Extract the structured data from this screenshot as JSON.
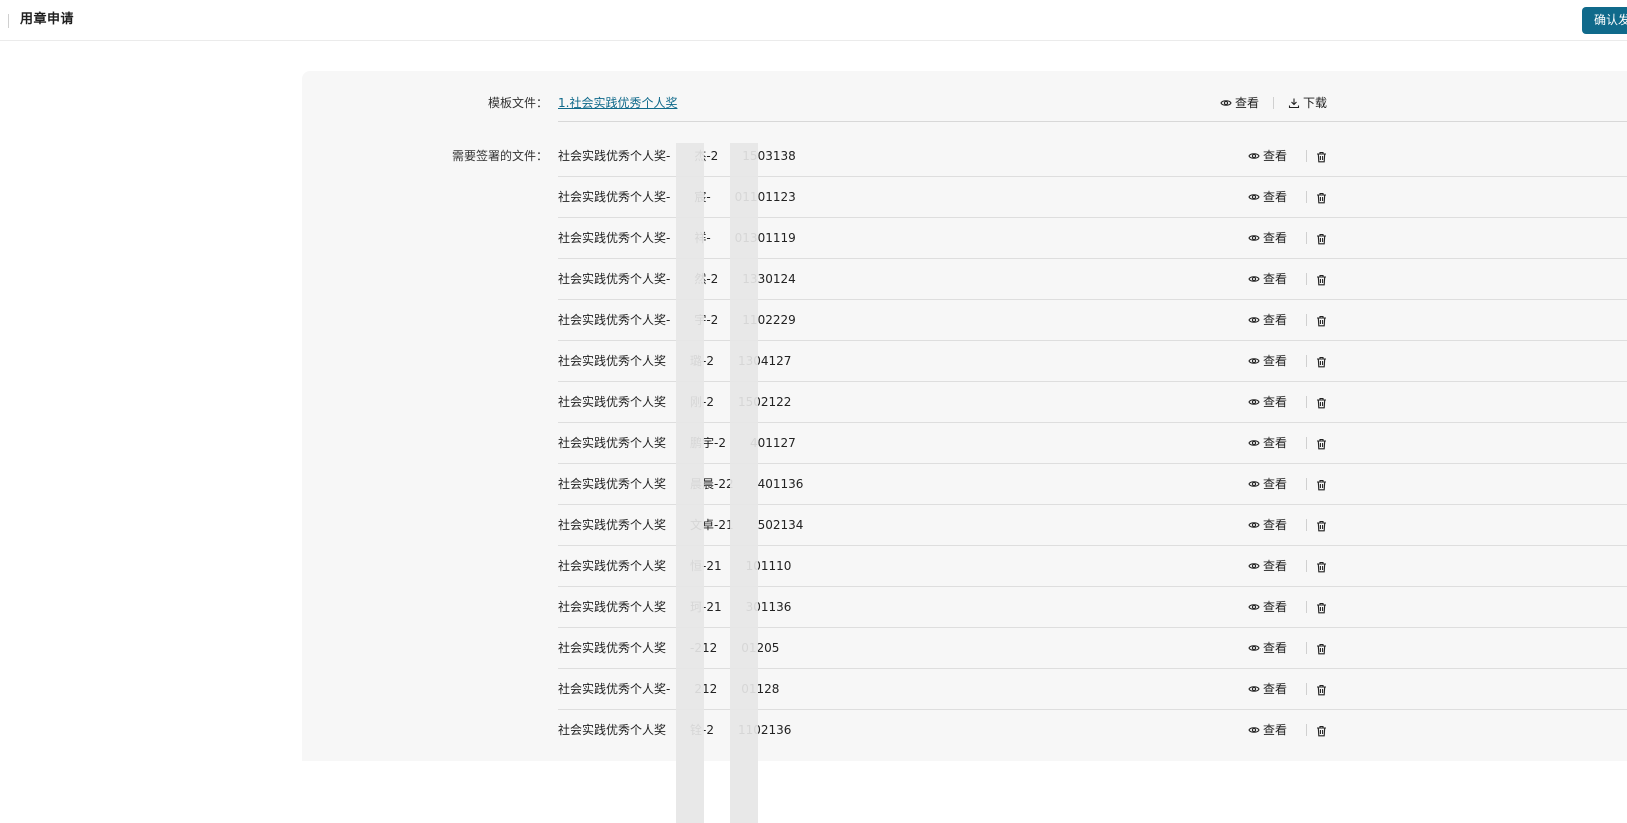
{
  "header": {
    "title": "用章申请",
    "confirm_label": "确认发"
  },
  "template": {
    "label": "模板文件：",
    "file_name": "1.社会实践优秀个人奖",
    "view_label": "查看",
    "download_label": "下载"
  },
  "files": {
    "label": "需要签署的文件：",
    "view_label": "查看",
    "items": [
      {
        "name": "社会实践优秀个人奖-　　杰-2　　1503138"
      },
      {
        "name": "社会实践优秀个人奖-　　宸-　　01101123"
      },
      {
        "name": "社会实践优秀个人奖-　　祥-　　01301119"
      },
      {
        "name": "社会实践优秀个人奖-　　然-2　　1330124"
      },
      {
        "name": "社会实践优秀个人奖-　　宇-2　　1102229"
      },
      {
        "name": "社会实践优秀个人奖　　璐-2　　1304127"
      },
      {
        "name": "社会实践优秀个人奖　　刚-2　　1502122"
      },
      {
        "name": "社会实践优秀个人奖　　鹏宇-2　　401127"
      },
      {
        "name": "社会实践优秀个人奖　　晨晨-22　　401136"
      },
      {
        "name": "社会实践优秀个人奖　　文卓-21　　502134"
      },
      {
        "name": "社会实践优秀个人奖　　恒-21　　101110"
      },
      {
        "name": "社会实践优秀个人奖　　珂-21　　301136"
      },
      {
        "name": "社会实践优秀个人奖　　-212　　01205"
      },
      {
        "name": "社会实践优秀个人奖-　　212　　01128"
      },
      {
        "name": "社会实践优秀个人奖　　铨-2　　1102136"
      }
    ]
  },
  "icons": {
    "view": "eye-icon",
    "download": "download-icon",
    "delete": "trash-icon"
  },
  "colors": {
    "primary": "#106a8b",
    "panel_bg": "#f7f7f7"
  }
}
